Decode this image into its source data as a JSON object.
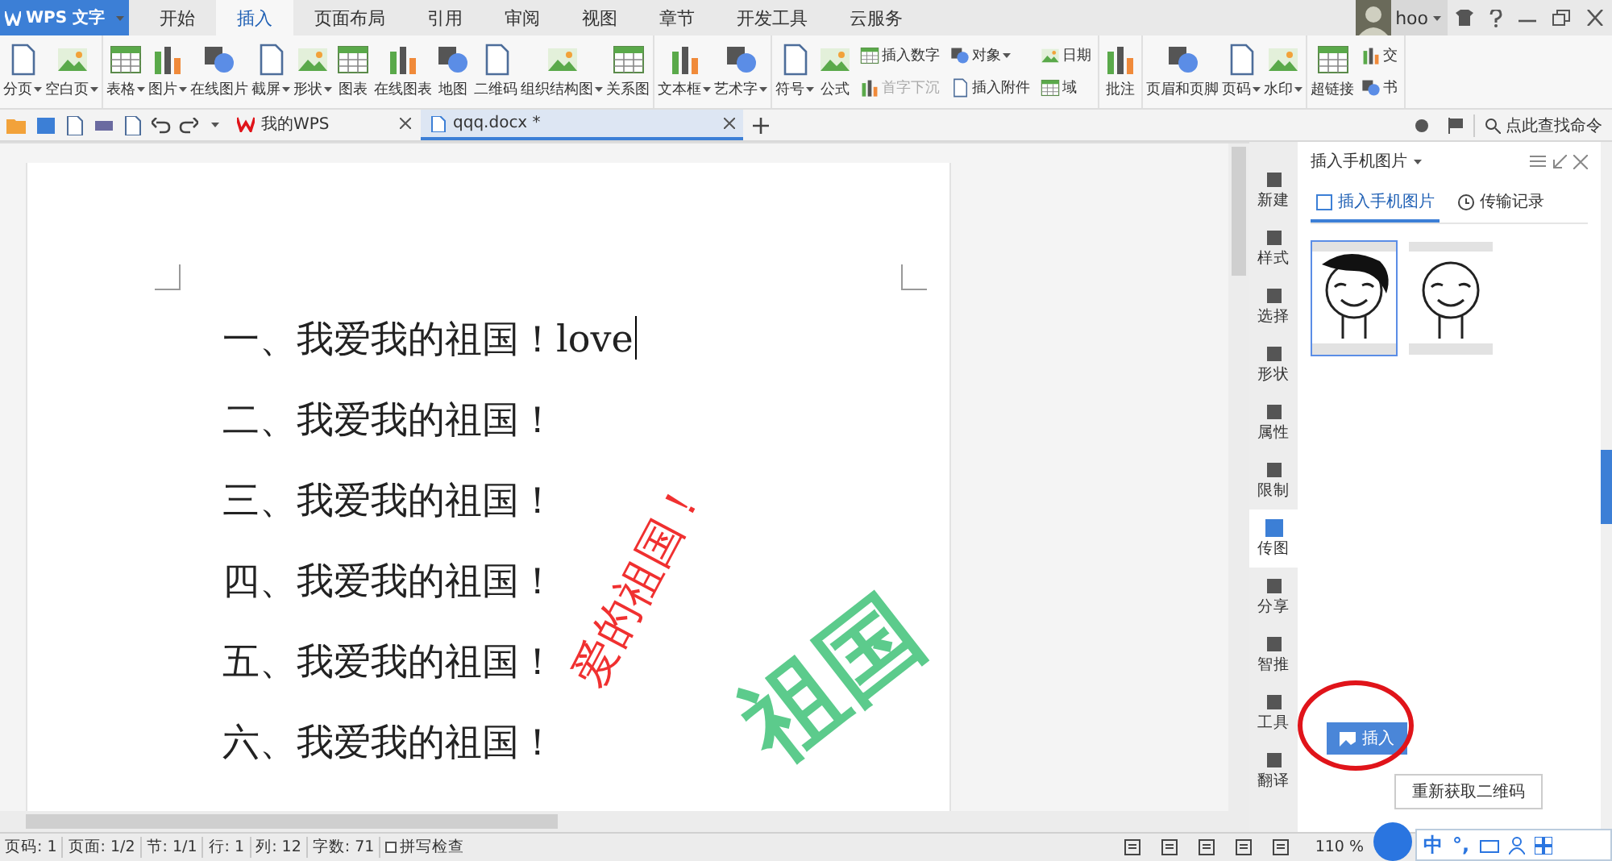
{
  "app_menu": {
    "label": "WPS 文字"
  },
  "menu_tabs": [
    {
      "label": "开始",
      "selected": false
    },
    {
      "label": "插入",
      "selected": true
    },
    {
      "label": "页面布局",
      "selected": false
    },
    {
      "label": "引用",
      "selected": false
    },
    {
      "label": "审阅",
      "selected": false
    },
    {
      "label": "视图",
      "selected": false
    },
    {
      "label": "章节",
      "selected": false
    },
    {
      "label": "开发工具",
      "selected": false
    },
    {
      "label": "云服务",
      "selected": false
    }
  ],
  "account": {
    "name": "hoo"
  },
  "ribbon": [
    {
      "items": [
        {
          "kind": "large",
          "label": "分页",
          "dropdown": true
        },
        {
          "kind": "large",
          "label": "空白页",
          "dropdown": true
        }
      ]
    },
    {
      "items": [
        {
          "kind": "large",
          "label": "表格",
          "dropdown": true
        },
        {
          "kind": "large",
          "label": "图片",
          "dropdown": true
        },
        {
          "kind": "large",
          "label": "在线图片",
          "dropdown": false
        },
        {
          "kind": "large",
          "label": "截屏",
          "dropdown": true
        },
        {
          "kind": "large",
          "label": "形状",
          "dropdown": true
        },
        {
          "kind": "large",
          "label": "图表",
          "dropdown": false
        },
        {
          "kind": "large",
          "label": "在线图表",
          "dropdown": false
        },
        {
          "kind": "large",
          "label": "地图",
          "dropdown": false
        },
        {
          "kind": "large",
          "label": "二维码",
          "dropdown": false
        },
        {
          "kind": "large",
          "label": "组织结构图",
          "dropdown": true
        },
        {
          "kind": "large",
          "label": "关系图",
          "dropdown": false
        }
      ]
    },
    {
      "items": [
        {
          "kind": "large",
          "label": "文本框",
          "dropdown": true
        },
        {
          "kind": "large",
          "label": "艺术字",
          "dropdown": true
        }
      ]
    },
    {
      "items": [
        {
          "kind": "large",
          "label": "符号",
          "dropdown": true
        },
        {
          "kind": "large",
          "label": "公式",
          "dropdown": false
        },
        {
          "kind": "stack",
          "rows": [
            {
              "label": "插入数字",
              "dropdown": false,
              "disabled": false
            },
            {
              "label": "首字下沉",
              "dropdown": false,
              "disabled": true
            }
          ]
        },
        {
          "kind": "stack",
          "rows": [
            {
              "label": "对象",
              "dropdown": true,
              "disabled": false
            },
            {
              "label": "插入附件",
              "dropdown": false,
              "disabled": false
            }
          ]
        },
        {
          "kind": "stack",
          "rows": [
            {
              "label": "日期",
              "dropdown": false,
              "disabled": false
            },
            {
              "label": "域",
              "dropdown": false,
              "disabled": false
            }
          ]
        }
      ]
    },
    {
      "items": [
        {
          "kind": "large",
          "label": "批注",
          "dropdown": false
        }
      ]
    },
    {
      "items": [
        {
          "kind": "large",
          "label": "页眉和页脚",
          "dropdown": false
        },
        {
          "kind": "large",
          "label": "页码",
          "dropdown": true
        },
        {
          "kind": "large",
          "label": "水印",
          "dropdown": true
        }
      ]
    },
    {
      "items": [
        {
          "kind": "large",
          "label": "超链接",
          "dropdown": false
        },
        {
          "kind": "stack",
          "rows": [
            {
              "label": "交",
              "dropdown": false,
              "disabled": false
            },
            {
              "label": "书",
              "dropdown": false,
              "disabled": false
            }
          ]
        }
      ]
    }
  ],
  "doc_tabs": [
    {
      "label": "我的WPS",
      "selected": false
    },
    {
      "label": "qqq.docx *",
      "selected": true
    }
  ],
  "command_search": {
    "placeholder": "点此查找命令"
  },
  "document": {
    "lines": [
      "一、我爱我的祖国！love",
      "二、我爱我的祖国！",
      "三、我爱我的祖国！",
      "四、我爱我的祖国！",
      "五、我爱我的祖国！",
      "六、我爱我的祖国！"
    ],
    "wordart": [
      {
        "text": "爱的祖国！",
        "color": "#f03030"
      },
      {
        "text": "祖国",
        "color": "#5ccb8c"
      }
    ]
  },
  "side_tools": [
    {
      "label": "新建",
      "selected": false
    },
    {
      "label": "样式",
      "selected": false
    },
    {
      "label": "选择",
      "selected": false
    },
    {
      "label": "形状",
      "selected": false
    },
    {
      "label": "属性",
      "selected": false
    },
    {
      "label": "限制",
      "selected": false
    },
    {
      "label": "传图",
      "selected": true
    },
    {
      "label": "分享",
      "selected": false
    },
    {
      "label": "智推",
      "selected": false
    },
    {
      "label": "工具",
      "selected": false
    },
    {
      "label": "翻译",
      "selected": false
    }
  ],
  "panel": {
    "title": "插入手机图片",
    "tabs": [
      {
        "label": "插入手机图片",
        "selected": true
      },
      {
        "label": "传输记录",
        "selected": false
      }
    ],
    "photos": [
      {
        "kind": "picture",
        "selected": true
      },
      {
        "kind": "picture",
        "selected": false
      }
    ],
    "insert_button": "插入",
    "refresh_button": "重新获取二维码"
  },
  "status_bar": {
    "items": [
      "页码: 1",
      "页面: 1/2",
      "节: 1/1",
      "行: 1",
      "列: 12",
      "字数: 71"
    ],
    "spell_check": {
      "label": "拼写检查",
      "checked": false
    },
    "zoom": "110 %"
  },
  "ime_bar": {
    "mode": "中",
    "punctuation": "°,"
  }
}
